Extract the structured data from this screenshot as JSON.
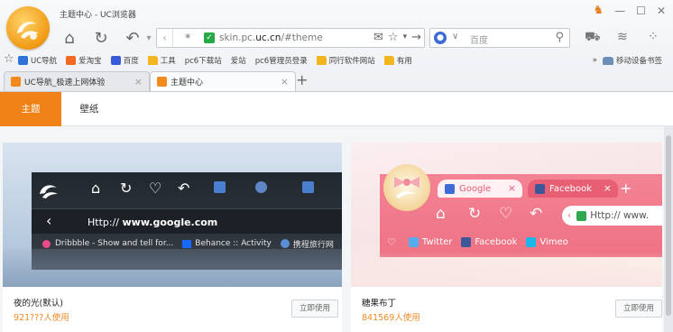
{
  "window": {
    "title": "主题中心 - UC浏览器",
    "controls": [
      "minimize",
      "maximize",
      "close"
    ]
  },
  "toolbar": {
    "address_prefix": "skin.pc.",
    "address_domain": "uc.cn",
    "address_path": "/#theme",
    "search_placeholder": "百度",
    "icons": [
      "home-icon",
      "refresh-icon",
      "undo-icon",
      "back-icon",
      "mail-icon",
      "star-icon",
      "forward-icon",
      "cart-icon",
      "wifi-icon",
      "apps-icon"
    ]
  },
  "bookmarks": {
    "items": [
      {
        "label": "UC导航",
        "icon": "uc"
      },
      {
        "label": "爱淘宝",
        "icon": "tb"
      },
      {
        "label": "百度",
        "icon": "bd"
      },
      {
        "label": "工具",
        "icon": "folder"
      },
      {
        "label": "pc6下载站",
        "icon": "page"
      },
      {
        "label": "爱站",
        "icon": "page"
      },
      {
        "label": "pc6管理员登录",
        "icon": "page"
      },
      {
        "label": "同行软件网站",
        "icon": "folder"
      },
      {
        "label": "有用",
        "icon": "folder"
      }
    ],
    "more": "»",
    "mobile_label": "移动设备书签"
  },
  "tabs": [
    {
      "label": "UC导航_极速上网体验",
      "active": false
    },
    {
      "label": "主题中心",
      "active": true
    }
  ],
  "subnav": {
    "items": [
      {
        "label": "主题",
        "active": true
      },
      {
        "label": "壁纸",
        "active": false
      }
    ]
  },
  "cards": [
    {
      "name": "夜的光(默认)",
      "count": "921???人使用",
      "button": "立即使用",
      "preview": {
        "url_prefix": "Http://",
        "url_bold": "www.google.com",
        "bookmarks": [
          "Dribbble - Show and tell for...",
          "Behance :: Activity",
          "携程旅行网"
        ],
        "accent": "#2c333b"
      }
    },
    {
      "name": "糖果布丁",
      "count": "841569人使用",
      "button": "立即使用",
      "preview": {
        "tabs": [
          "Google",
          "Facebook"
        ],
        "url_text": "Http:// www.",
        "bookmarks": [
          "Twitter",
          "Facebook",
          "Vimeo"
        ],
        "accent": "#f07a8c"
      }
    }
  ],
  "colors": {
    "accent_orange": "#f08115",
    "count_orange": "#f08a24"
  }
}
